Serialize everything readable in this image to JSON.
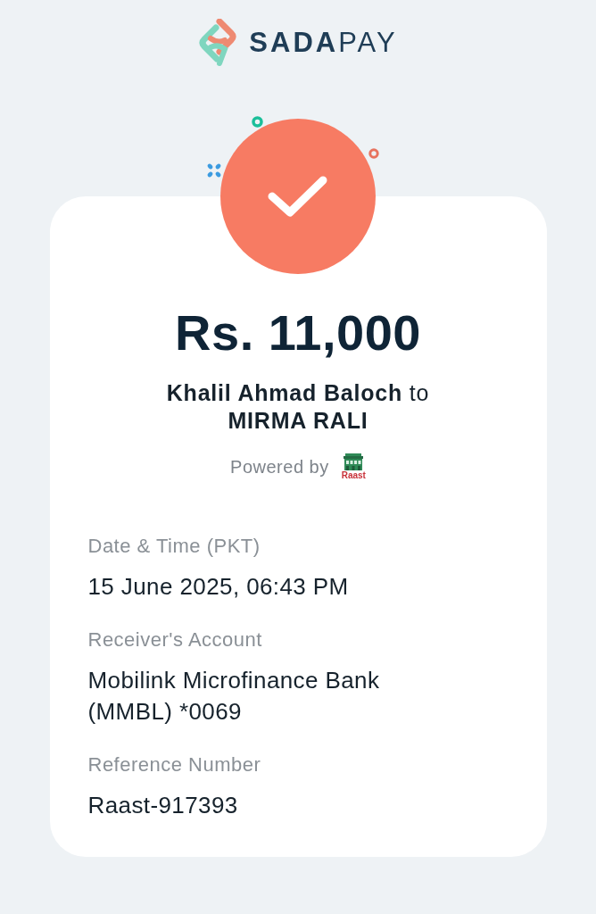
{
  "logo": {
    "wordmark": "**SADA**PAY"
  },
  "receipt": {
    "amount": "Rs. 11,000",
    "sender": "Khalil Ahmad Baloch",
    "connector": "to",
    "receiver": "MIRMA RALI",
    "powered_by": {
      "label": "Powered by",
      "partner": "Raast"
    }
  },
  "details": [
    {
      "label": "Date & Time (PKT)",
      "value": "15 June 2025, 06:43 PM"
    },
    {
      "label": "Receiver's Account",
      "value": "Mobilink Microfinance Bank (MMBL) *0069"
    },
    {
      "label": "Reference Number",
      "value": "Raast-917393"
    }
  ]
}
